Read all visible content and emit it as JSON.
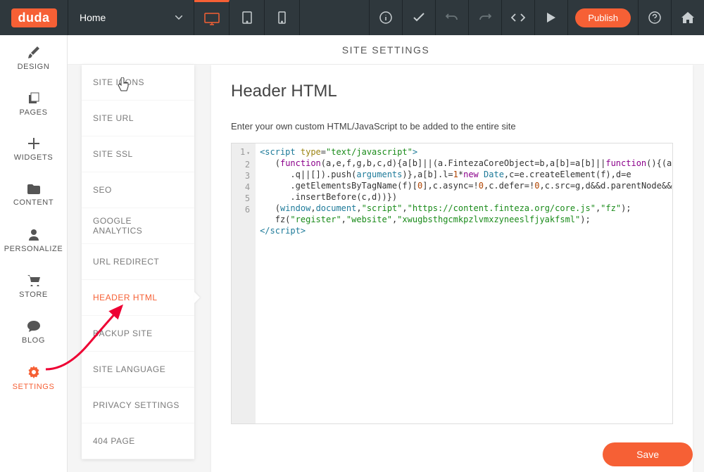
{
  "topbar": {
    "logo": "duda",
    "section_label": "Home",
    "publish_label": "Publish"
  },
  "leftnav": {
    "items": [
      {
        "label": "DESIGN"
      },
      {
        "label": "PAGES"
      },
      {
        "label": "WIDGETS"
      },
      {
        "label": "CONTENT"
      },
      {
        "label": "PERSONALIZE"
      },
      {
        "label": "STORE"
      },
      {
        "label": "BLOG"
      },
      {
        "label": "SETTINGS"
      }
    ]
  },
  "panel": {
    "title": "SITE SETTINGS"
  },
  "settings_menu": {
    "items": [
      {
        "label": "SITE ICONS"
      },
      {
        "label": "SITE URL"
      },
      {
        "label": "SITE SSL"
      },
      {
        "label": "SEO"
      },
      {
        "label": "GOOGLE ANALYTICS"
      },
      {
        "label": "URL REDIRECT"
      },
      {
        "label": "HEADER HTML"
      },
      {
        "label": "BACKUP SITE"
      },
      {
        "label": "SITE LANGUAGE"
      },
      {
        "label": "PRIVACY SETTINGS"
      },
      {
        "label": "404 PAGE"
      }
    ],
    "active_index": 6
  },
  "content": {
    "heading": "Header HTML",
    "description": "Enter your own custom HTML/JavaScript to be added to the entire site",
    "save_label": "Save"
  },
  "code": {
    "lines": [
      "1",
      "2",
      "3",
      "4",
      "5",
      "6"
    ],
    "l3_url": "\"https://content.finteza.org/core.js\"",
    "l3_fz": "\"fz\"",
    "l4_a": "\"register\"",
    "l4_b": "\"website\"",
    "l4_c": "\"xwugbsthgcmkpzlvmxzyneeslfjyakfsml\"",
    "script_type": "\"text/javascript\""
  }
}
